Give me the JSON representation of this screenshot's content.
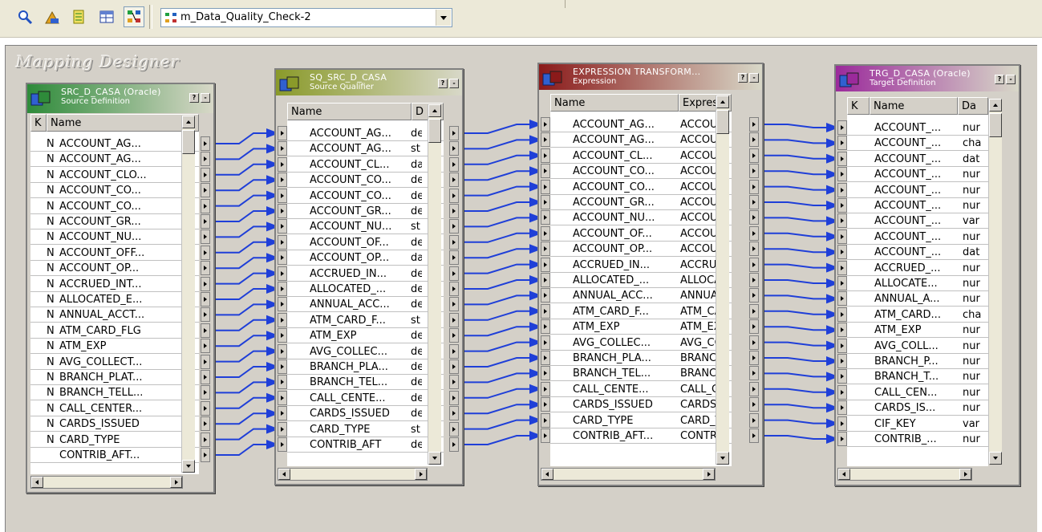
{
  "toolbar": {
    "tools": [
      {
        "icon": "source-analyzer-icon"
      },
      {
        "icon": "target-designer-icon"
      },
      {
        "icon": "transformation-developer-icon"
      },
      {
        "icon": "mapplet-designer-icon"
      },
      {
        "icon": "mapping-designer-icon",
        "pressed": true
      }
    ],
    "mapping_select": {
      "value": "m_Data_Quality_Check-2",
      "icon": "mapping-icon"
    }
  },
  "workspace": {
    "title": "Mapping Designer"
  },
  "transformations": [
    {
      "id": "source",
      "name": "SRC_D_CASA (Oracle)",
      "type": "Source Definition",
      "header_color": "#2e8b3a",
      "columns": [
        "K",
        "Name"
      ],
      "rows": [
        [
          "N",
          "ACCOUNT_AG..."
        ],
        [
          "N",
          "ACCOUNT_AG..."
        ],
        [
          "N",
          "ACCOUNT_CLO..."
        ],
        [
          "N",
          "ACCOUNT_CO..."
        ],
        [
          "N",
          "ACCOUNT_CO..."
        ],
        [
          "N",
          "ACCOUNT_GR..."
        ],
        [
          "N",
          "ACCOUNT_NU..."
        ],
        [
          "N",
          "ACCOUNT_OFF..."
        ],
        [
          "N",
          "ACCOUNT_OP..."
        ],
        [
          "N",
          "ACCRUED_INT..."
        ],
        [
          "N",
          "ALLOCATED_E..."
        ],
        [
          "N",
          "ANNUAL_ACCT..."
        ],
        [
          "N",
          "ATM_CARD_FLG"
        ],
        [
          "N",
          "ATM_EXP"
        ],
        [
          "N",
          "AVG_COLLECT..."
        ],
        [
          "N",
          "BRANCH_PLAT..."
        ],
        [
          "N",
          "BRANCH_TELL..."
        ],
        [
          "N",
          "CALL_CENTER..."
        ],
        [
          "N",
          "CARDS_ISSUED"
        ],
        [
          "N",
          "CARD_TYPE"
        ],
        [
          "",
          "CONTRIB_AFT..."
        ]
      ]
    },
    {
      "id": "source-qualifier",
      "name": "SQ_SRC_D_CASA",
      "type": "Source Qualifier",
      "header_color": "#8a9a2a",
      "columns": [
        "Name",
        "D"
      ],
      "rows": [
        [
          "ACCOUNT_AG...",
          "de"
        ],
        [
          "ACCOUNT_AG...",
          "st"
        ],
        [
          "ACCOUNT_CL...",
          "da"
        ],
        [
          "ACCOUNT_CO...",
          "de"
        ],
        [
          "ACCOUNT_CO...",
          "de"
        ],
        [
          "ACCOUNT_GR...",
          "de"
        ],
        [
          "ACCOUNT_NU...",
          "st"
        ],
        [
          "ACCOUNT_OF...",
          "de"
        ],
        [
          "ACCOUNT_OP...",
          "da"
        ],
        [
          "ACCRUED_IN...",
          "de"
        ],
        [
          "ALLOCATED_...",
          "de"
        ],
        [
          "ANNUAL_ACC...",
          "de"
        ],
        [
          "ATM_CARD_F...",
          "st"
        ],
        [
          "ATM_EXP",
          "de"
        ],
        [
          "AVG_COLLEC...",
          "de"
        ],
        [
          "BRANCH_PLA...",
          "de"
        ],
        [
          "BRANCH_TEL...",
          "de"
        ],
        [
          "CALL_CENTE...",
          "de"
        ],
        [
          "CARDS_ISSUED",
          "de"
        ],
        [
          "CARD_TYPE",
          "st"
        ],
        [
          "CONTRIB_AFT",
          "de"
        ]
      ]
    },
    {
      "id": "expression",
      "name": "EXPRESSION TRANSFORM...",
      "type": "Expression",
      "header_color": "#8b1a1a",
      "columns": [
        "Name",
        "Expressi"
      ],
      "rows": [
        [
          "ACCOUNT_AG...",
          "ACCOUI"
        ],
        [
          "ACCOUNT_AG...",
          "ACCOUI"
        ],
        [
          "ACCOUNT_CL...",
          "ACCOUI"
        ],
        [
          "ACCOUNT_CO...",
          "ACCOUI"
        ],
        [
          "ACCOUNT_CO...",
          "ACCOUI"
        ],
        [
          "ACCOUNT_GR...",
          "ACCOUI"
        ],
        [
          "ACCOUNT_NU...",
          "ACCOUI"
        ],
        [
          "ACCOUNT_OF...",
          "ACCOUI"
        ],
        [
          "ACCOUNT_OP...",
          "ACCOUI"
        ],
        [
          "ACCRUED_IN...",
          "ACCRUI"
        ],
        [
          "ALLOCATED_...",
          "ALLOCA"
        ],
        [
          "ANNUAL_ACC...",
          "ANNUA"
        ],
        [
          "ATM_CARD_F...",
          "ATM_CA"
        ],
        [
          "ATM_EXP",
          "ATM_EX"
        ],
        [
          "AVG_COLLEC...",
          "AVG_CO"
        ],
        [
          "BRANCH_PLA...",
          "BRANCI"
        ],
        [
          "BRANCH_TEL...",
          "BRANCI"
        ],
        [
          "CALL_CENTE...",
          "CALL_C"
        ],
        [
          "CARDS_ISSUED",
          "CARDS_"
        ],
        [
          "CARD_TYPE",
          "CARD_T"
        ],
        [
          "CONTRIB_AFT...",
          "CONTRI"
        ]
      ]
    },
    {
      "id": "target",
      "name": "TRG_D_CASA (Oracle)",
      "type": "Target Definition",
      "header_color": "#9b2a9b",
      "columns": [
        "K",
        "Name",
        "Da"
      ],
      "rows": [
        [
          "",
          "ACCOUNT_...",
          "nur"
        ],
        [
          "",
          "ACCOUNT_...",
          "cha"
        ],
        [
          "",
          "ACCOUNT_...",
          "dat"
        ],
        [
          "",
          "ACCOUNT_...",
          "nur"
        ],
        [
          "",
          "ACCOUNT_...",
          "nur"
        ],
        [
          "",
          "ACCOUNT_...",
          "nur"
        ],
        [
          "",
          "ACCOUNT_...",
          "var"
        ],
        [
          "",
          "ACCOUNT_...",
          "nur"
        ],
        [
          "",
          "ACCOUNT_...",
          "dat"
        ],
        [
          "",
          "ACCRUED_...",
          "nur"
        ],
        [
          "",
          "ALLOCATE...",
          "nur"
        ],
        [
          "",
          "ANNUAL_A...",
          "nur"
        ],
        [
          "",
          "ATM_CARD...",
          "cha"
        ],
        [
          "",
          "ATM_EXP",
          "nur"
        ],
        [
          "",
          "AVG_COLL...",
          "nur"
        ],
        [
          "",
          "BRANCH_P...",
          "nur"
        ],
        [
          "",
          "BRANCH_T...",
          "nur"
        ],
        [
          "",
          "CALL_CEN...",
          "nur"
        ],
        [
          "",
          "CARDS_IS...",
          "nur"
        ],
        [
          "",
          "CIF_KEY",
          "var"
        ],
        [
          "",
          "CONTRIB_...",
          "nur"
        ]
      ]
    }
  ]
}
